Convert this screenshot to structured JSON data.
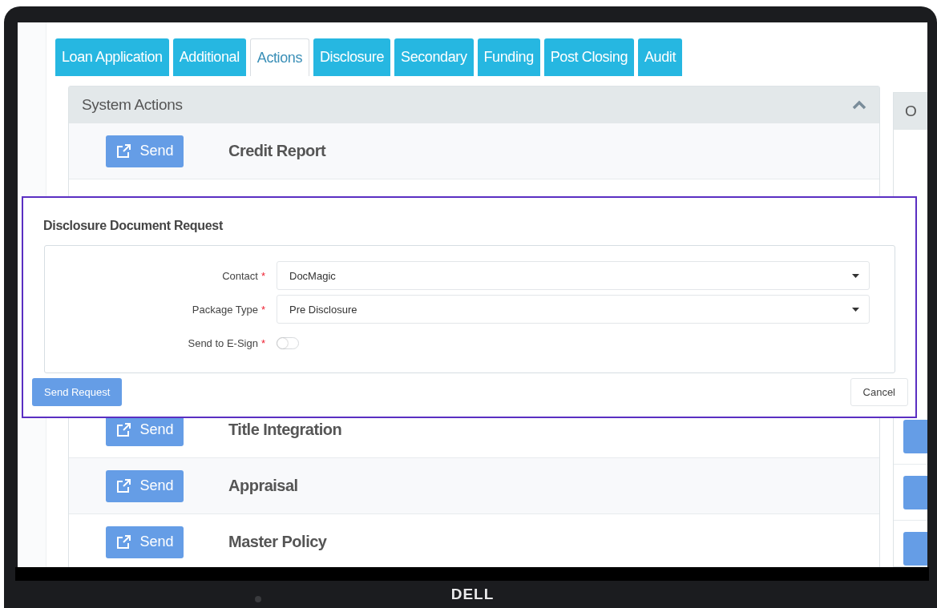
{
  "tabs": [
    {
      "label": "Loan Application",
      "selected": false
    },
    {
      "label": "Additional",
      "selected": false
    },
    {
      "label": "Actions",
      "selected": true
    },
    {
      "label": "Disclosure",
      "selected": false
    },
    {
      "label": "Secondary",
      "selected": false
    },
    {
      "label": "Funding",
      "selected": false
    },
    {
      "label": "Post Closing",
      "selected": false
    },
    {
      "label": "Audit",
      "selected": false
    }
  ],
  "panel": {
    "title": "System Actions",
    "expanded": true,
    "rows_top": [
      {
        "button": "Send",
        "label": "Credit Report"
      }
    ],
    "rows_bottom": [
      {
        "button": "Send",
        "label": "Title Integration"
      },
      {
        "button": "Send",
        "label": "Appraisal"
      },
      {
        "button": "Send",
        "label": "Master Policy"
      }
    ]
  },
  "side_panel": {
    "title": "O"
  },
  "dialog": {
    "title": "Disclosure Document Request",
    "fields": [
      {
        "kind": "select",
        "label": "Contact",
        "required_mark": "*",
        "value": "DocMagic"
      },
      {
        "kind": "select",
        "label": "Package Type",
        "required_mark": "*",
        "value": "Pre Disclosure"
      },
      {
        "kind": "toggle",
        "label": "Send to E-Sign",
        "required_mark": "*",
        "on": false
      }
    ],
    "buttons": [
      {
        "label": "Send Request",
        "kind": "primary"
      },
      {
        "label": "Cancel",
        "kind": "secondary"
      }
    ]
  },
  "bezel": {
    "logo": "DELL"
  }
}
